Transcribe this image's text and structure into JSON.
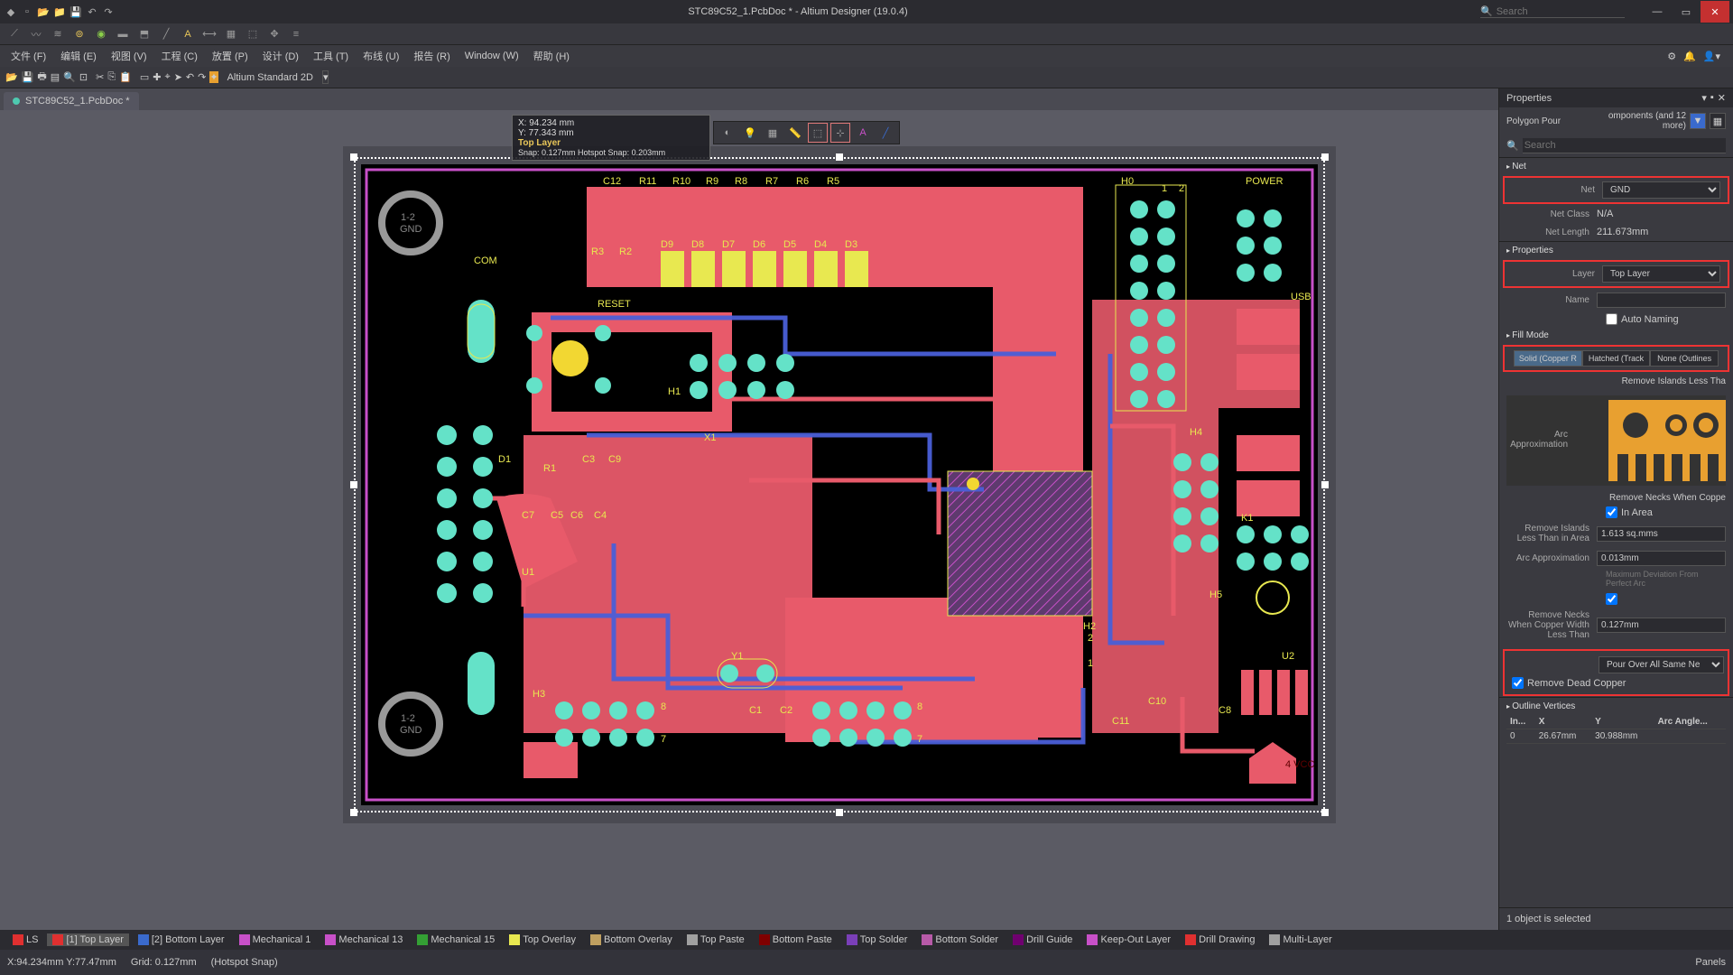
{
  "title": "STC89C52_1.PcbDoc * - Altium Designer (19.0.4)",
  "search_placeholder": "Search",
  "menus": [
    "文件 (F)",
    "编辑 (E)",
    "视图 (V)",
    "工程 (C)",
    "放置 (P)",
    "设计 (D)",
    "工具 (T)",
    "布线 (U)",
    "报告 (R)",
    "Window (W)",
    "帮助 (H)"
  ],
  "toolbar2_label": "Altium Standard 2D",
  "tab": "STC89C52_1.PcbDoc *",
  "coord": {
    "x": "X: 94.234  mm",
    "y": "Y: 77.343  mm",
    "layer": "Top Layer",
    "snap": "Snap: 0.127mm Hotspot Snap: 0.203mm"
  },
  "layers": [
    {
      "name": "LS",
      "color": "#e03030"
    },
    {
      "name": "[1] Top Layer",
      "color": "#e03030",
      "active": true
    },
    {
      "name": "[2] Bottom Layer",
      "color": "#3a6acc"
    },
    {
      "name": "Mechanical 1",
      "color": "#c850c8"
    },
    {
      "name": "Mechanical 13",
      "color": "#c850c8"
    },
    {
      "name": "Mechanical 15",
      "color": "#34a034"
    },
    {
      "name": "Top Overlay",
      "color": "#e8e850"
    },
    {
      "name": "Bottom Overlay",
      "color": "#c0a060"
    },
    {
      "name": "Top Paste",
      "color": "#a0a0a0"
    },
    {
      "name": "Bottom Paste",
      "color": "#800000"
    },
    {
      "name": "Top Solder",
      "color": "#7a3fb8"
    },
    {
      "name": "Bottom Solder",
      "color": "#b85aa8"
    },
    {
      "name": "Drill Guide",
      "color": "#700070"
    },
    {
      "name": "Keep-Out Layer",
      "color": "#c850c8"
    },
    {
      "name": "Drill Drawing",
      "color": "#e03030"
    },
    {
      "name": "Multi-Layer",
      "color": "#a0a0a0"
    }
  ],
  "status": {
    "pos": "X:94.234mm Y:77.47mm",
    "grid": "Grid: 0.127mm",
    "snap": "(Hotspot Snap)",
    "panels": "Panels"
  },
  "props": {
    "title": "Properties",
    "object": "Polygon Pour",
    "filter": "omponents (and 12 more)",
    "search_ph": "Search",
    "sections": {
      "net": "Net",
      "properties": "Properties",
      "fillmode": "Fill Mode",
      "outline": "Outline Vertices"
    },
    "net": {
      "net_lbl": "Net",
      "net": "GND",
      "class_lbl": "Net Class",
      "class": "N/A",
      "len_lbl": "Net Length",
      "len": "211.673mm"
    },
    "layer_lbl": "Layer",
    "layer": "Top Layer",
    "name_lbl": "Name",
    "name": "",
    "auto": "Auto Naming",
    "fill": {
      "solid": "Solid (Copper R",
      "hatched": "Hatched (Track",
      "none": "None (Outlines"
    },
    "islands_hdr": "Remove Islands Less Tha",
    "arc_lbl": "Arc Approximation",
    "necks_hdr": "Remove Necks When Coppe",
    "inarea": "In Area",
    "ri_lbl": "Remove Islands Less Than in Area",
    "ri_val": "1.613 sq.mms",
    "aa_lbl": "Arc Approximation",
    "aa_val": "0.013mm",
    "aa_note": "Maximum Deviation From Perfect Arc",
    "rn_lbl": "Remove Necks When Copper Width Less Than",
    "rn_val": "0.127mm",
    "pour": "Pour Over All Same Ne",
    "dead": "Remove Dead Copper",
    "vcols": [
      "In...",
      "X",
      "Y",
      "Arc Angle..."
    ],
    "vrow": [
      "0",
      "26.67mm",
      "30.988mm",
      ""
    ],
    "selmsg": "1 object is selected"
  },
  "silk": {
    "C12": "C12",
    "R11": "R11",
    "R10": "R10",
    "R9": "R9",
    "R8": "R8",
    "R7": "R7",
    "R6": "R6",
    "R5": "R5",
    "H0": "H0",
    "POWER": "POWER",
    "COM": "COM",
    "R3": "R3",
    "R2": "R2",
    "D9": "D9",
    "D8": "D8",
    "D7": "D7",
    "D6": "D6",
    "D5": "D5",
    "D4": "D4",
    "D3": "D3",
    "RESET": "RESET",
    "USB": "USB",
    "D1": "D1",
    "R1": "R1",
    "C3": "C3",
    "C9": "C9",
    "X1": "X1",
    "H1": "H1",
    "H4": "H4",
    "C7": "C7",
    "C5": "C5",
    "C6": "C6",
    "C4": "C4",
    "H5": "H5",
    "U1": "U1",
    "U2": "U2",
    "K1": "K1",
    "H3": "H3",
    "H2": "H2",
    "C1": "C1",
    "C2": "C2",
    "C10": "C10",
    "C11": "C11",
    "C8": "C8",
    "Y1": "Y1",
    "GND1": "1-2\nGND",
    "GND2": "1-2\nGND",
    "VCC": "4\nVCC",
    "n1": "1",
    "n2": "2",
    "n7": "7",
    "n8": "8"
  }
}
